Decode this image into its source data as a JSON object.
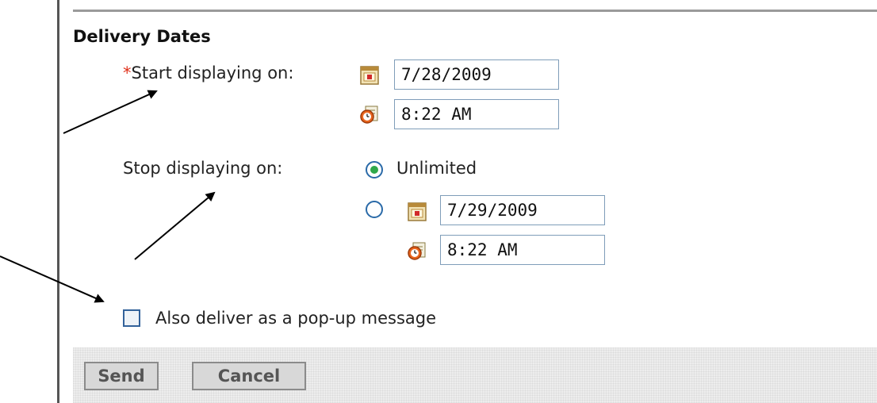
{
  "section": {
    "title": "Delivery Dates"
  },
  "start": {
    "required_mark": "*",
    "label": "Start displaying on:",
    "date_value": "7/28/2009",
    "time_value": "8:22 AM",
    "calendar_icon": "calendar-icon",
    "clock_icon": "clock-icon"
  },
  "stop": {
    "label": "Stop displaying on:",
    "unlimited_label": "Unlimited",
    "unlimited_selected": true,
    "date_value": "7/29/2009",
    "time_value": "8:22 AM",
    "calendar_icon": "calendar-icon",
    "clock_icon": "clock-icon"
  },
  "popup": {
    "label": "Also deliver as a pop-up message",
    "checked": false
  },
  "buttons": {
    "send": "Send",
    "cancel": "Cancel"
  },
  "colors": {
    "required": "#e0311b",
    "field_border": "#7f9db9",
    "radio_dot": "#2fa84a"
  }
}
